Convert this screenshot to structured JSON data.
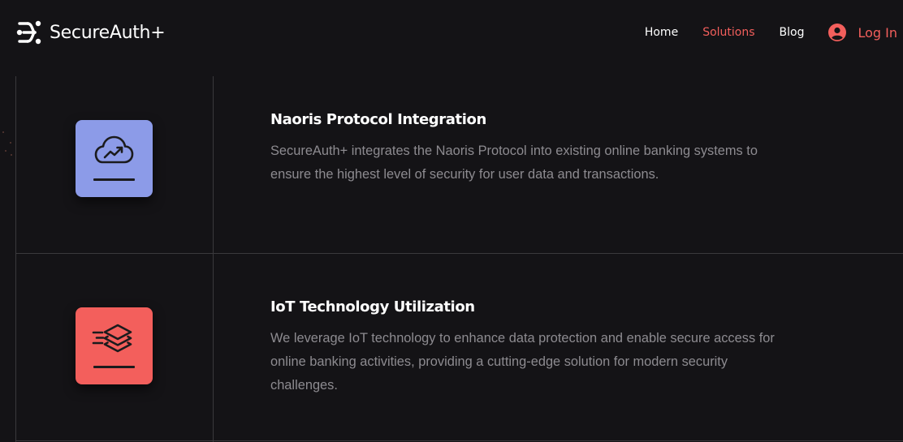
{
  "header": {
    "brand": "SecureAuth+",
    "nav": [
      {
        "label": "Home",
        "active": false
      },
      {
        "label": "Solutions",
        "active": true
      },
      {
        "label": "Blog",
        "active": false
      }
    ],
    "login_label": "Log In"
  },
  "colors": {
    "background": "#141316",
    "accent": "#f35f5c",
    "feature_1_icon_bg": "#8c9be8",
    "feature_2_icon_bg": "#f35f5c",
    "description_text": "#8d8b90",
    "divider": "#3a393c"
  },
  "features": [
    {
      "icon": "cloud-growth-icon",
      "title": "Naoris Protocol Integration",
      "description_lines": [
        "SecureAuth+ integrates the Naoris Protocol into existing online banking systems to",
        "ensure the highest level of security for user data and transactions."
      ]
    },
    {
      "icon": "layers-speed-icon",
      "title": "IoT Technology Utilization",
      "description_lines": [
        "We leverage IoT technology to enhance data protection and enable secure access for",
        "online banking activities, providing a cutting-edge solution for modern security",
        "challenges."
      ]
    }
  ]
}
